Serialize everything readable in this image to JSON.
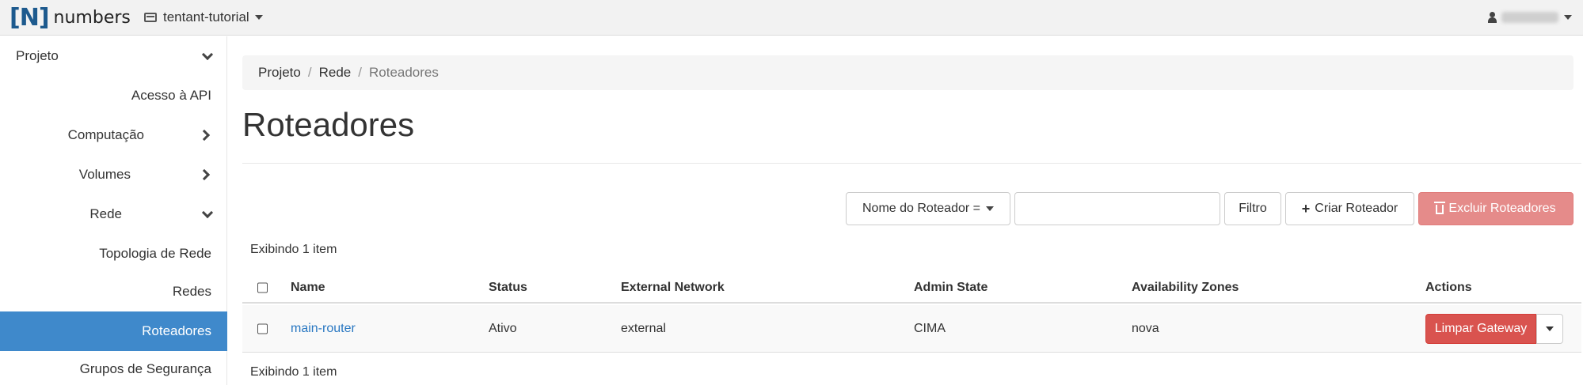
{
  "topbar": {
    "brand_mark": "[N]",
    "brand_word": "numbers",
    "project_name": "tentant-tutorial"
  },
  "sidebar": {
    "items": [
      {
        "label": "Projeto"
      },
      {
        "label": "Acesso à API"
      },
      {
        "label": "Computação"
      },
      {
        "label": "Volumes"
      },
      {
        "label": "Rede"
      },
      {
        "label": "Topologia de Rede"
      },
      {
        "label": "Redes"
      },
      {
        "label": "Roteadores"
      },
      {
        "label": "Grupos de Segurança"
      }
    ]
  },
  "breadcrumb": {
    "items": [
      "Projeto",
      "Rede",
      "Roteadores"
    ],
    "separator": "/"
  },
  "page": {
    "title": "Roteadores"
  },
  "toolbar": {
    "filter_select_label": "Nome do Roteador =",
    "search_value": "",
    "filter_button": "Filtro",
    "create_button": "Criar Roteador",
    "delete_button": "Excluir Roteadores"
  },
  "table": {
    "count_top": "Exibindo 1 item",
    "count_bottom": "Exibindo 1 item",
    "columns": [
      "Name",
      "Status",
      "External Network",
      "Admin State",
      "Availability Zones",
      "Actions"
    ],
    "rows": [
      {
        "name": "main-router",
        "status": "Ativo",
        "external_network": "external",
        "admin_state": "CIMA",
        "availability_zones": "nova",
        "action_label": "Limpar Gateway"
      }
    ]
  },
  "colors": {
    "active_nav": "#3f89cb",
    "danger": "#d9534f",
    "danger_disabled": "#e58b8a",
    "link": "#2a78c2"
  }
}
